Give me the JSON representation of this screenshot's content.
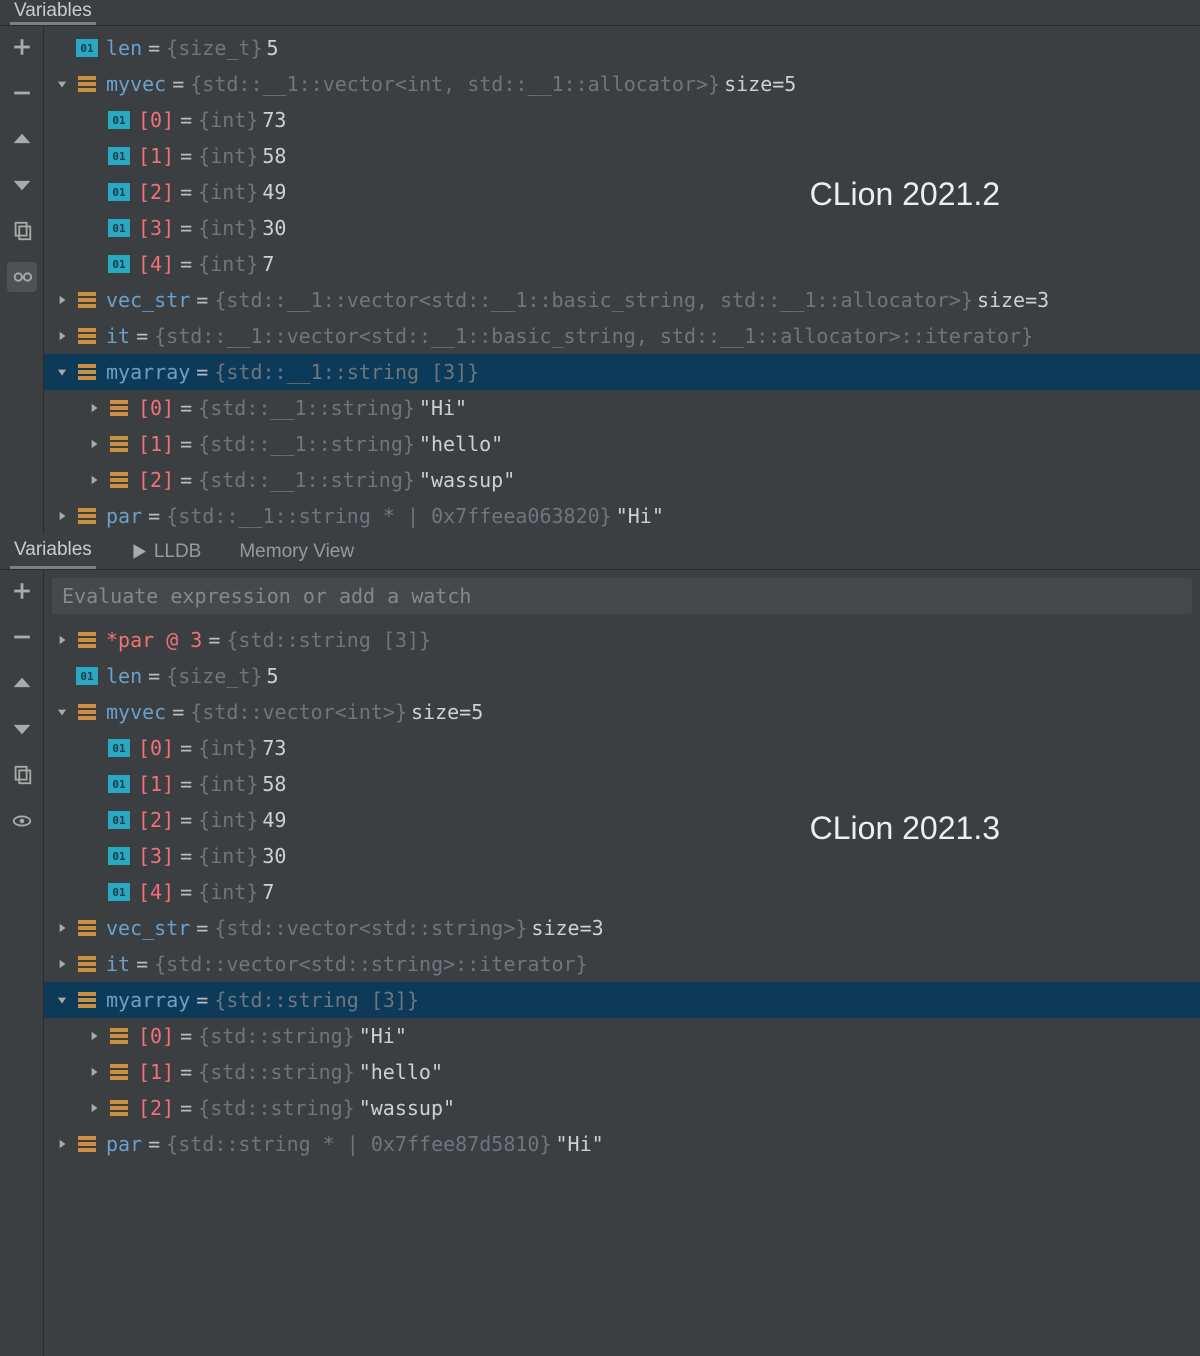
{
  "top": {
    "label": "CLion 2021.2",
    "tabs": [
      "Variables"
    ],
    "eval_placeholder": "",
    "rows": [
      {
        "depth": 0,
        "exp": "",
        "icon": "prim",
        "name": "len",
        "nameClass": "blue",
        "type": "{size_t}",
        "value": "5"
      },
      {
        "depth": 0,
        "exp": "open",
        "icon": "obj",
        "name": "myvec",
        "nameClass": "blue",
        "type": "{std::__1::vector<int, std::__1::allocator>}",
        "value": "size=5"
      },
      {
        "depth": 1,
        "exp": "",
        "icon": "prim",
        "name": "[0]",
        "nameClass": "",
        "type": "{int}",
        "value": "73"
      },
      {
        "depth": 1,
        "exp": "",
        "icon": "prim",
        "name": "[1]",
        "nameClass": "",
        "type": "{int}",
        "value": "58"
      },
      {
        "depth": 1,
        "exp": "",
        "icon": "prim",
        "name": "[2]",
        "nameClass": "",
        "type": "{int}",
        "value": "49"
      },
      {
        "depth": 1,
        "exp": "",
        "icon": "prim",
        "name": "[3]",
        "nameClass": "",
        "type": "{int}",
        "value": "30"
      },
      {
        "depth": 1,
        "exp": "",
        "icon": "prim",
        "name": "[4]",
        "nameClass": "",
        "type": "{int}",
        "value": "7"
      },
      {
        "depth": 0,
        "exp": "closed",
        "icon": "obj",
        "name": "vec_str",
        "nameClass": "blue",
        "type": "{std::__1::vector<std::__1::basic_string, std::__1::allocator>}",
        "value": "size=3"
      },
      {
        "depth": 0,
        "exp": "closed",
        "icon": "obj",
        "name": "it",
        "nameClass": "blue",
        "type": "{std::__1::vector<std::__1::basic_string, std::__1::allocator>::iterator}",
        "value": ""
      },
      {
        "depth": 0,
        "exp": "open",
        "icon": "obj",
        "name": "myarray",
        "nameClass": "blue",
        "type": "{std::__1::string [3]}",
        "value": "",
        "selected": true
      },
      {
        "depth": 1,
        "exp": "closed",
        "icon": "obj",
        "name": "[0]",
        "nameClass": "",
        "type": "{std::__1::string}",
        "value": "\"Hi\""
      },
      {
        "depth": 1,
        "exp": "closed",
        "icon": "obj",
        "name": "[1]",
        "nameClass": "",
        "type": "{std::__1::string}",
        "value": "\"hello\""
      },
      {
        "depth": 1,
        "exp": "closed",
        "icon": "obj",
        "name": "[2]",
        "nameClass": "",
        "type": "{std::__1::string}",
        "value": "\"wassup\""
      },
      {
        "depth": 0,
        "exp": "closed",
        "icon": "obj",
        "name": "par",
        "nameClass": "blue",
        "type": "{std::__1::string * | 0x7ffeea063820}",
        "value": "\"Hi\""
      }
    ]
  },
  "bottom": {
    "label": "CLion 2021.3",
    "tabs": [
      "Variables",
      "LLDB",
      "Memory View"
    ],
    "eval_placeholder": "Evaluate expression or add a watch",
    "rows": [
      {
        "depth": 0,
        "exp": "closed",
        "icon": "obj",
        "name": "*par @ 3",
        "nameClass": "",
        "type": "{std::string [3]}",
        "value": ""
      },
      {
        "depth": 0,
        "exp": "",
        "icon": "prim",
        "name": "len",
        "nameClass": "blue",
        "type": "{size_t}",
        "value": "5"
      },
      {
        "depth": 0,
        "exp": "open",
        "icon": "obj",
        "name": "myvec",
        "nameClass": "blue",
        "type": "{std::vector<int>}",
        "value": "size=5"
      },
      {
        "depth": 1,
        "exp": "",
        "icon": "prim",
        "name": "[0]",
        "nameClass": "",
        "type": "{int}",
        "value": "73"
      },
      {
        "depth": 1,
        "exp": "",
        "icon": "prim",
        "name": "[1]",
        "nameClass": "",
        "type": "{int}",
        "value": "58"
      },
      {
        "depth": 1,
        "exp": "",
        "icon": "prim",
        "name": "[2]",
        "nameClass": "",
        "type": "{int}",
        "value": "49"
      },
      {
        "depth": 1,
        "exp": "",
        "icon": "prim",
        "name": "[3]",
        "nameClass": "",
        "type": "{int}",
        "value": "30"
      },
      {
        "depth": 1,
        "exp": "",
        "icon": "prim",
        "name": "[4]",
        "nameClass": "",
        "type": "{int}",
        "value": "7"
      },
      {
        "depth": 0,
        "exp": "closed",
        "icon": "obj",
        "name": "vec_str",
        "nameClass": "blue",
        "type": "{std::vector<std::string>}",
        "value": "size=3"
      },
      {
        "depth": 0,
        "exp": "closed",
        "icon": "obj",
        "name": "it",
        "nameClass": "blue",
        "type": "{std::vector<std::string>::iterator}",
        "value": ""
      },
      {
        "depth": 0,
        "exp": "open",
        "icon": "obj",
        "name": "myarray",
        "nameClass": "blue",
        "type": "{std::string [3]}",
        "value": "",
        "selected": true
      },
      {
        "depth": 1,
        "exp": "closed",
        "icon": "obj",
        "name": "[0]",
        "nameClass": "",
        "type": "{std::string}",
        "value": "\"Hi\""
      },
      {
        "depth": 1,
        "exp": "closed",
        "icon": "obj",
        "name": "[1]",
        "nameClass": "",
        "type": "{std::string}",
        "value": "\"hello\""
      },
      {
        "depth": 1,
        "exp": "closed",
        "icon": "obj",
        "name": "[2]",
        "nameClass": "",
        "type": "{std::string}",
        "value": "\"wassup\""
      },
      {
        "depth": 0,
        "exp": "closed",
        "icon": "obj",
        "name": "par",
        "nameClass": "blue",
        "type": "{std::string * | 0x7ffee87d5810}",
        "value": "\"Hi\""
      }
    ]
  },
  "toolbar_icons_top": [
    "plus",
    "minus",
    "up",
    "down",
    "copy",
    "glasses"
  ],
  "toolbar_icons_bottom": [
    "plus",
    "minus",
    "up",
    "down",
    "copy",
    "eye"
  ]
}
